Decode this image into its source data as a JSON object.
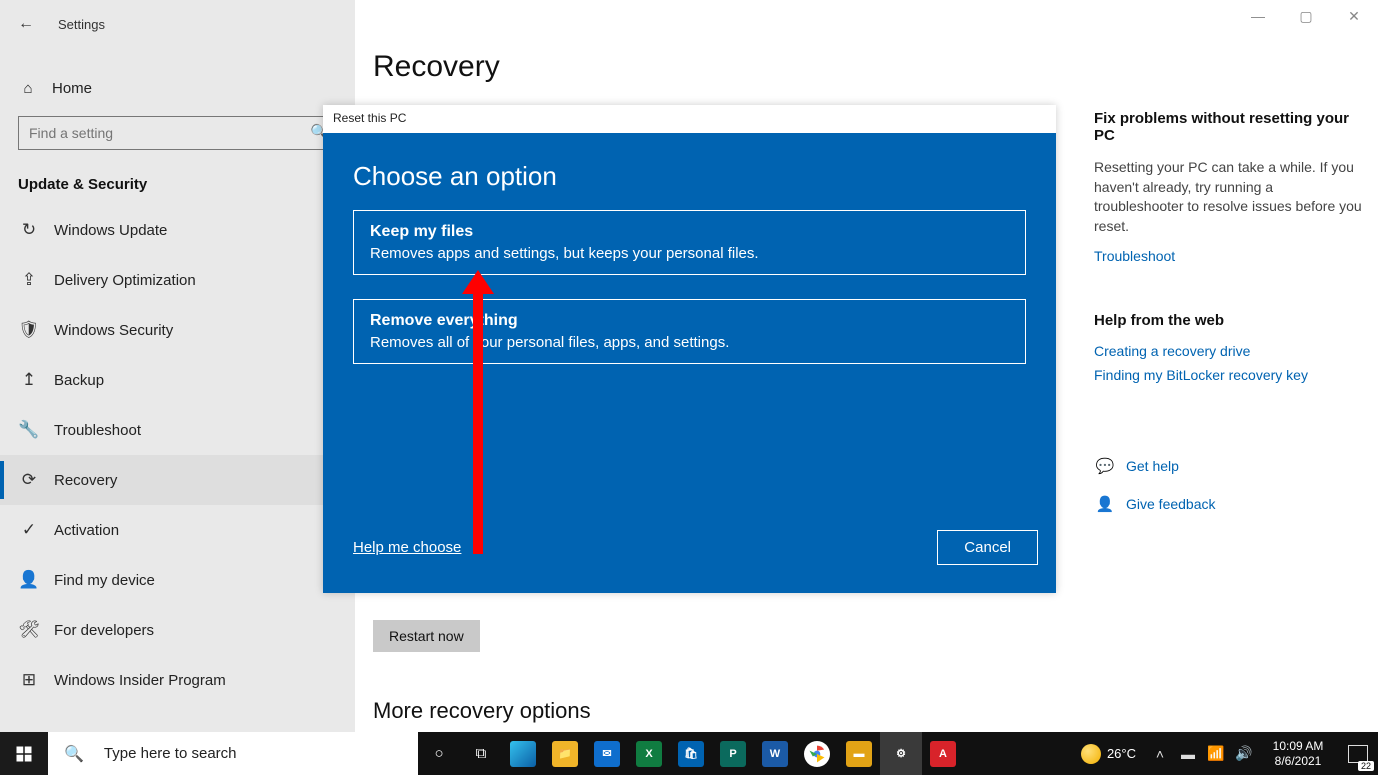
{
  "header": {
    "app_name": "Settings"
  },
  "sidebar": {
    "home_label": "Home",
    "search_placeholder": "Find a setting",
    "section_title": "Update & Security",
    "items": [
      {
        "label": "Windows Update",
        "icon": "↻"
      },
      {
        "label": "Delivery Optimization",
        "icon": "⇪"
      },
      {
        "label": "Windows Security",
        "icon": "🛡"
      },
      {
        "label": "Backup",
        "icon": "↥"
      },
      {
        "label": "Troubleshoot",
        "icon": "🔧"
      },
      {
        "label": "Recovery",
        "icon": "⟳",
        "active": true
      },
      {
        "label": "Activation",
        "icon": "✓"
      },
      {
        "label": "Find my device",
        "icon": "👤"
      },
      {
        "label": "For developers",
        "icon": "🛠"
      },
      {
        "label": "Windows Insider Program",
        "icon": "⊞"
      }
    ]
  },
  "main": {
    "page_title": "Recovery",
    "restart_button": "Restart now",
    "more_title": "More recovery options"
  },
  "right": {
    "section1_title": "Fix problems without resetting your PC",
    "section1_body": "Resetting your PC can take a while. If you haven't already, try running a troubleshooter to resolve issues before you reset.",
    "link_troubleshoot": "Troubleshoot",
    "section2_title": "Help from the web",
    "link_recovery_drive": "Creating a recovery drive",
    "link_bitlocker": "Finding my BitLocker recovery key",
    "get_help": "Get help",
    "give_feedback": "Give feedback"
  },
  "dialog": {
    "titlebar": "Reset this PC",
    "heading": "Choose an option",
    "option1_title": "Keep my files",
    "option1_desc": "Removes apps and settings, but keeps your personal files.",
    "option2_title": "Remove everything",
    "option2_desc": "Removes all of your personal files, apps, and settings.",
    "help_link": "Help me choose",
    "cancel": "Cancel"
  },
  "taskbar": {
    "search_placeholder": "Type here to search",
    "temperature": "26°C",
    "time": "10:09 AM",
    "date": "8/6/2021",
    "notif_count": "22"
  }
}
